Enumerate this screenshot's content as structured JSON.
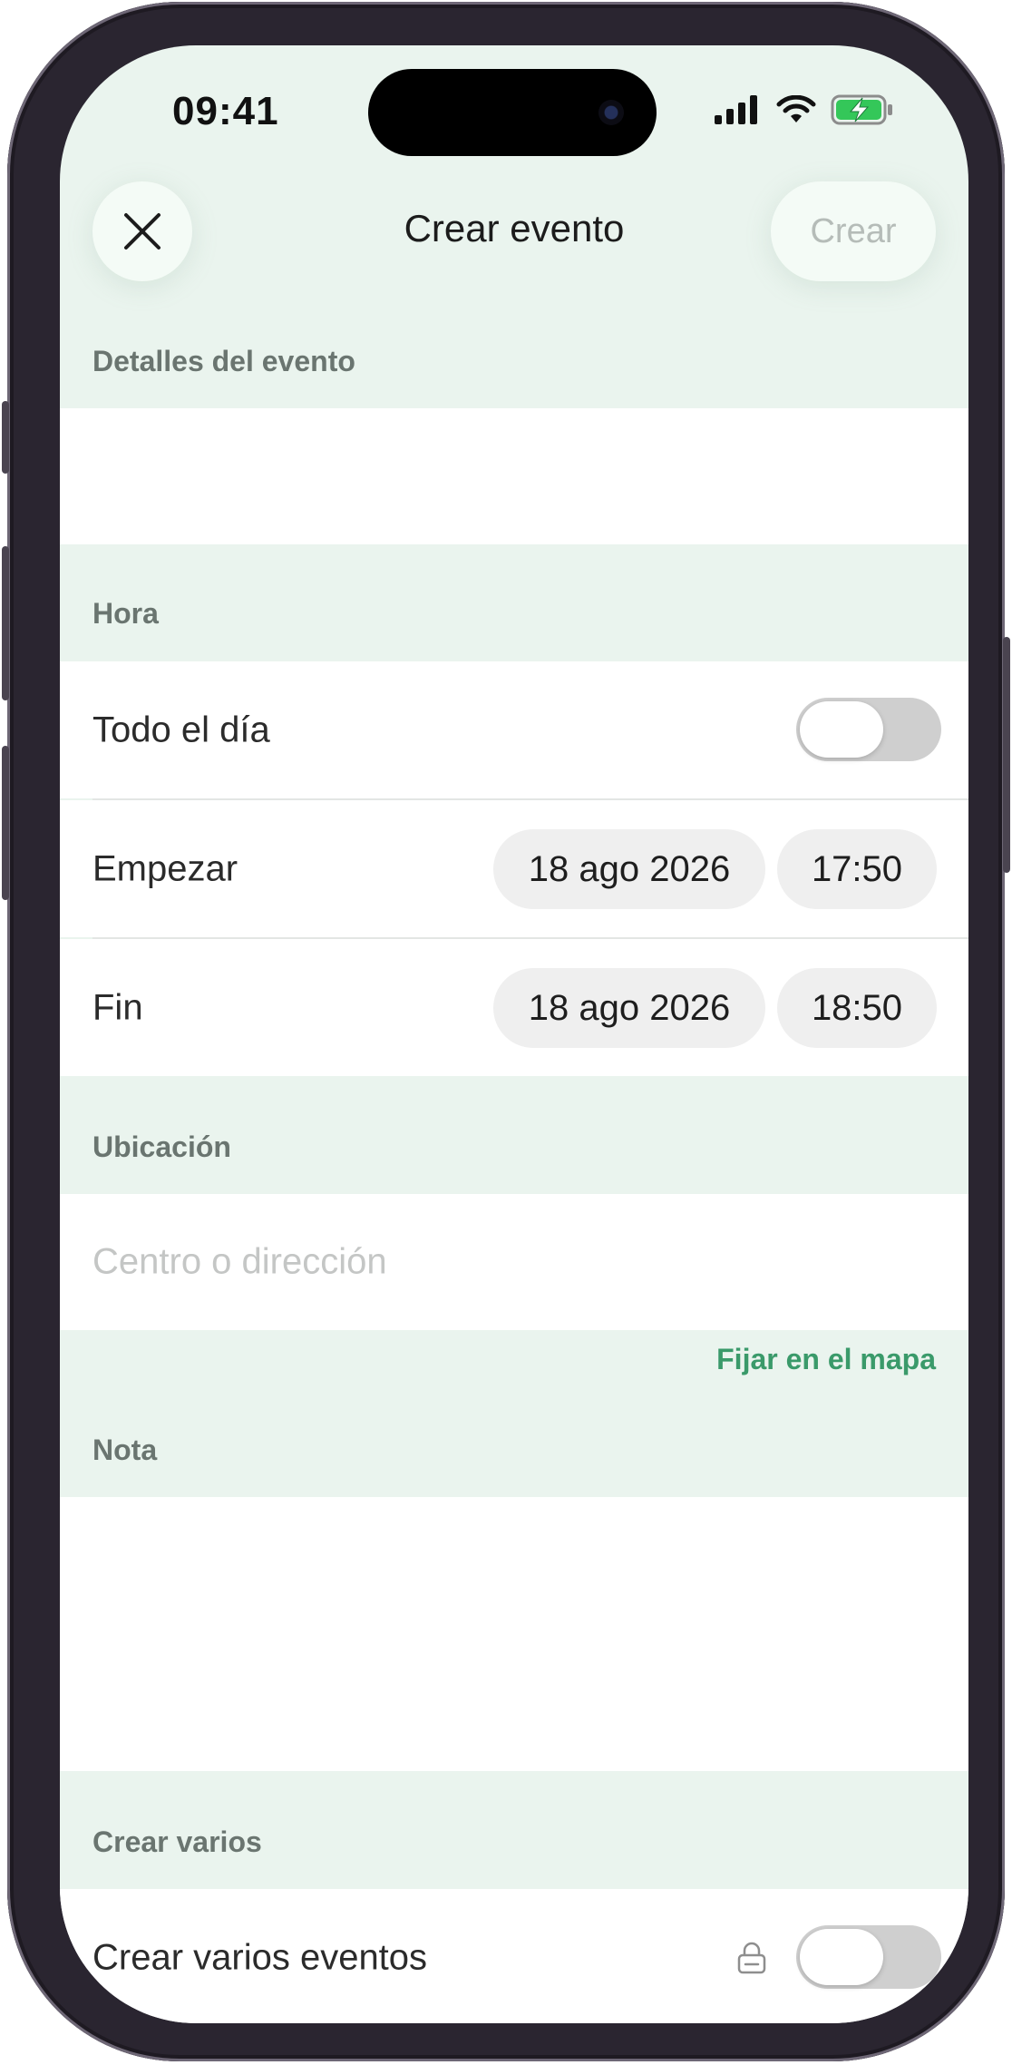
{
  "status_bar": {
    "time": "09:41"
  },
  "header": {
    "title": "Crear evento",
    "create_label": "Crear"
  },
  "sections": {
    "details": {
      "label": "Detalles del evento"
    },
    "time": {
      "label": "Hora"
    },
    "location": {
      "label": "Ubicación",
      "placeholder": "Centro o dirección",
      "map_link": "Fijar en el mapa"
    },
    "note": {
      "label": "Nota"
    },
    "multiple": {
      "label": "Crear varios"
    }
  },
  "time_rows": {
    "all_day": {
      "label": "Todo el día",
      "enabled": false
    },
    "start": {
      "label": "Empezar",
      "date": "18 ago 2026",
      "time": "17:50"
    },
    "end": {
      "label": "Fin",
      "date": "18 ago 2026",
      "time": "18:50"
    }
  },
  "multiple_row": {
    "label": "Crear varios eventos",
    "enabled": false
  },
  "icons": {
    "close": "close-icon",
    "signal": "cellular-signal-icon",
    "wifi": "wifi-icon",
    "battery": "battery-charging-icon",
    "lock": "lock-icon"
  },
  "colors": {
    "background_tint": "#eaf4ee",
    "accent": "#3a9a6a",
    "battery_green": "#34c759"
  }
}
